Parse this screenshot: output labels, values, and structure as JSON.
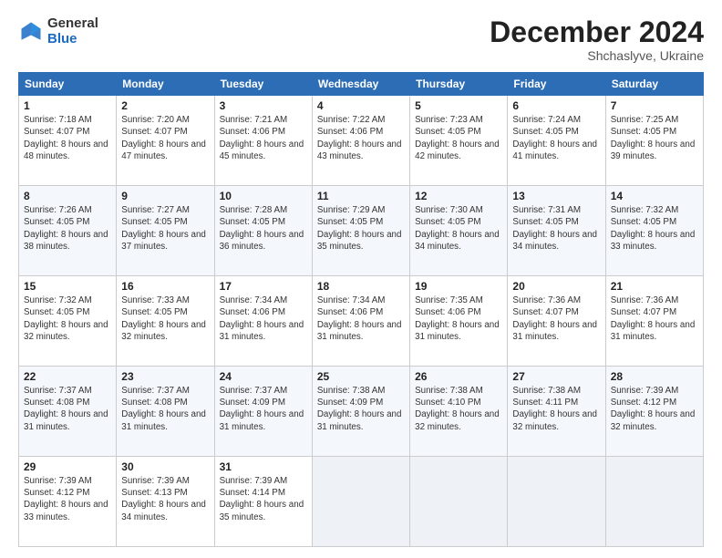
{
  "header": {
    "logo_general": "General",
    "logo_blue": "Blue",
    "month_title": "December 2024",
    "subtitle": "Shchaslyve, Ukraine"
  },
  "weekdays": [
    "Sunday",
    "Monday",
    "Tuesday",
    "Wednesday",
    "Thursday",
    "Friday",
    "Saturday"
  ],
  "weeks": [
    [
      {
        "day": "1",
        "info": "Sunrise: 7:18 AM\nSunset: 4:07 PM\nDaylight: 8 hours and 48 minutes."
      },
      {
        "day": "2",
        "info": "Sunrise: 7:20 AM\nSunset: 4:07 PM\nDaylight: 8 hours and 47 minutes."
      },
      {
        "day": "3",
        "info": "Sunrise: 7:21 AM\nSunset: 4:06 PM\nDaylight: 8 hours and 45 minutes."
      },
      {
        "day": "4",
        "info": "Sunrise: 7:22 AM\nSunset: 4:06 PM\nDaylight: 8 hours and 43 minutes."
      },
      {
        "day": "5",
        "info": "Sunrise: 7:23 AM\nSunset: 4:05 PM\nDaylight: 8 hours and 42 minutes."
      },
      {
        "day": "6",
        "info": "Sunrise: 7:24 AM\nSunset: 4:05 PM\nDaylight: 8 hours and 41 minutes."
      },
      {
        "day": "7",
        "info": "Sunrise: 7:25 AM\nSunset: 4:05 PM\nDaylight: 8 hours and 39 minutes."
      }
    ],
    [
      {
        "day": "8",
        "info": "Sunrise: 7:26 AM\nSunset: 4:05 PM\nDaylight: 8 hours and 38 minutes."
      },
      {
        "day": "9",
        "info": "Sunrise: 7:27 AM\nSunset: 4:05 PM\nDaylight: 8 hours and 37 minutes."
      },
      {
        "day": "10",
        "info": "Sunrise: 7:28 AM\nSunset: 4:05 PM\nDaylight: 8 hours and 36 minutes."
      },
      {
        "day": "11",
        "info": "Sunrise: 7:29 AM\nSunset: 4:05 PM\nDaylight: 8 hours and 35 minutes."
      },
      {
        "day": "12",
        "info": "Sunrise: 7:30 AM\nSunset: 4:05 PM\nDaylight: 8 hours and 34 minutes."
      },
      {
        "day": "13",
        "info": "Sunrise: 7:31 AM\nSunset: 4:05 PM\nDaylight: 8 hours and 34 minutes."
      },
      {
        "day": "14",
        "info": "Sunrise: 7:32 AM\nSunset: 4:05 PM\nDaylight: 8 hours and 33 minutes."
      }
    ],
    [
      {
        "day": "15",
        "info": "Sunrise: 7:32 AM\nSunset: 4:05 PM\nDaylight: 8 hours and 32 minutes."
      },
      {
        "day": "16",
        "info": "Sunrise: 7:33 AM\nSunset: 4:05 PM\nDaylight: 8 hours and 32 minutes."
      },
      {
        "day": "17",
        "info": "Sunrise: 7:34 AM\nSunset: 4:06 PM\nDaylight: 8 hours and 31 minutes."
      },
      {
        "day": "18",
        "info": "Sunrise: 7:34 AM\nSunset: 4:06 PM\nDaylight: 8 hours and 31 minutes."
      },
      {
        "day": "19",
        "info": "Sunrise: 7:35 AM\nSunset: 4:06 PM\nDaylight: 8 hours and 31 minutes."
      },
      {
        "day": "20",
        "info": "Sunrise: 7:36 AM\nSunset: 4:07 PM\nDaylight: 8 hours and 31 minutes."
      },
      {
        "day": "21",
        "info": "Sunrise: 7:36 AM\nSunset: 4:07 PM\nDaylight: 8 hours and 31 minutes."
      }
    ],
    [
      {
        "day": "22",
        "info": "Sunrise: 7:37 AM\nSunset: 4:08 PM\nDaylight: 8 hours and 31 minutes."
      },
      {
        "day": "23",
        "info": "Sunrise: 7:37 AM\nSunset: 4:08 PM\nDaylight: 8 hours and 31 minutes."
      },
      {
        "day": "24",
        "info": "Sunrise: 7:37 AM\nSunset: 4:09 PM\nDaylight: 8 hours and 31 minutes."
      },
      {
        "day": "25",
        "info": "Sunrise: 7:38 AM\nSunset: 4:09 PM\nDaylight: 8 hours and 31 minutes."
      },
      {
        "day": "26",
        "info": "Sunrise: 7:38 AM\nSunset: 4:10 PM\nDaylight: 8 hours and 32 minutes."
      },
      {
        "day": "27",
        "info": "Sunrise: 7:38 AM\nSunset: 4:11 PM\nDaylight: 8 hours and 32 minutes."
      },
      {
        "day": "28",
        "info": "Sunrise: 7:39 AM\nSunset: 4:12 PM\nDaylight: 8 hours and 32 minutes."
      }
    ],
    [
      {
        "day": "29",
        "info": "Sunrise: 7:39 AM\nSunset: 4:12 PM\nDaylight: 8 hours and 33 minutes."
      },
      {
        "day": "30",
        "info": "Sunrise: 7:39 AM\nSunset: 4:13 PM\nDaylight: 8 hours and 34 minutes."
      },
      {
        "day": "31",
        "info": "Sunrise: 7:39 AM\nSunset: 4:14 PM\nDaylight: 8 hours and 35 minutes."
      },
      {
        "day": "",
        "info": ""
      },
      {
        "day": "",
        "info": ""
      },
      {
        "day": "",
        "info": ""
      },
      {
        "day": "",
        "info": ""
      }
    ]
  ]
}
